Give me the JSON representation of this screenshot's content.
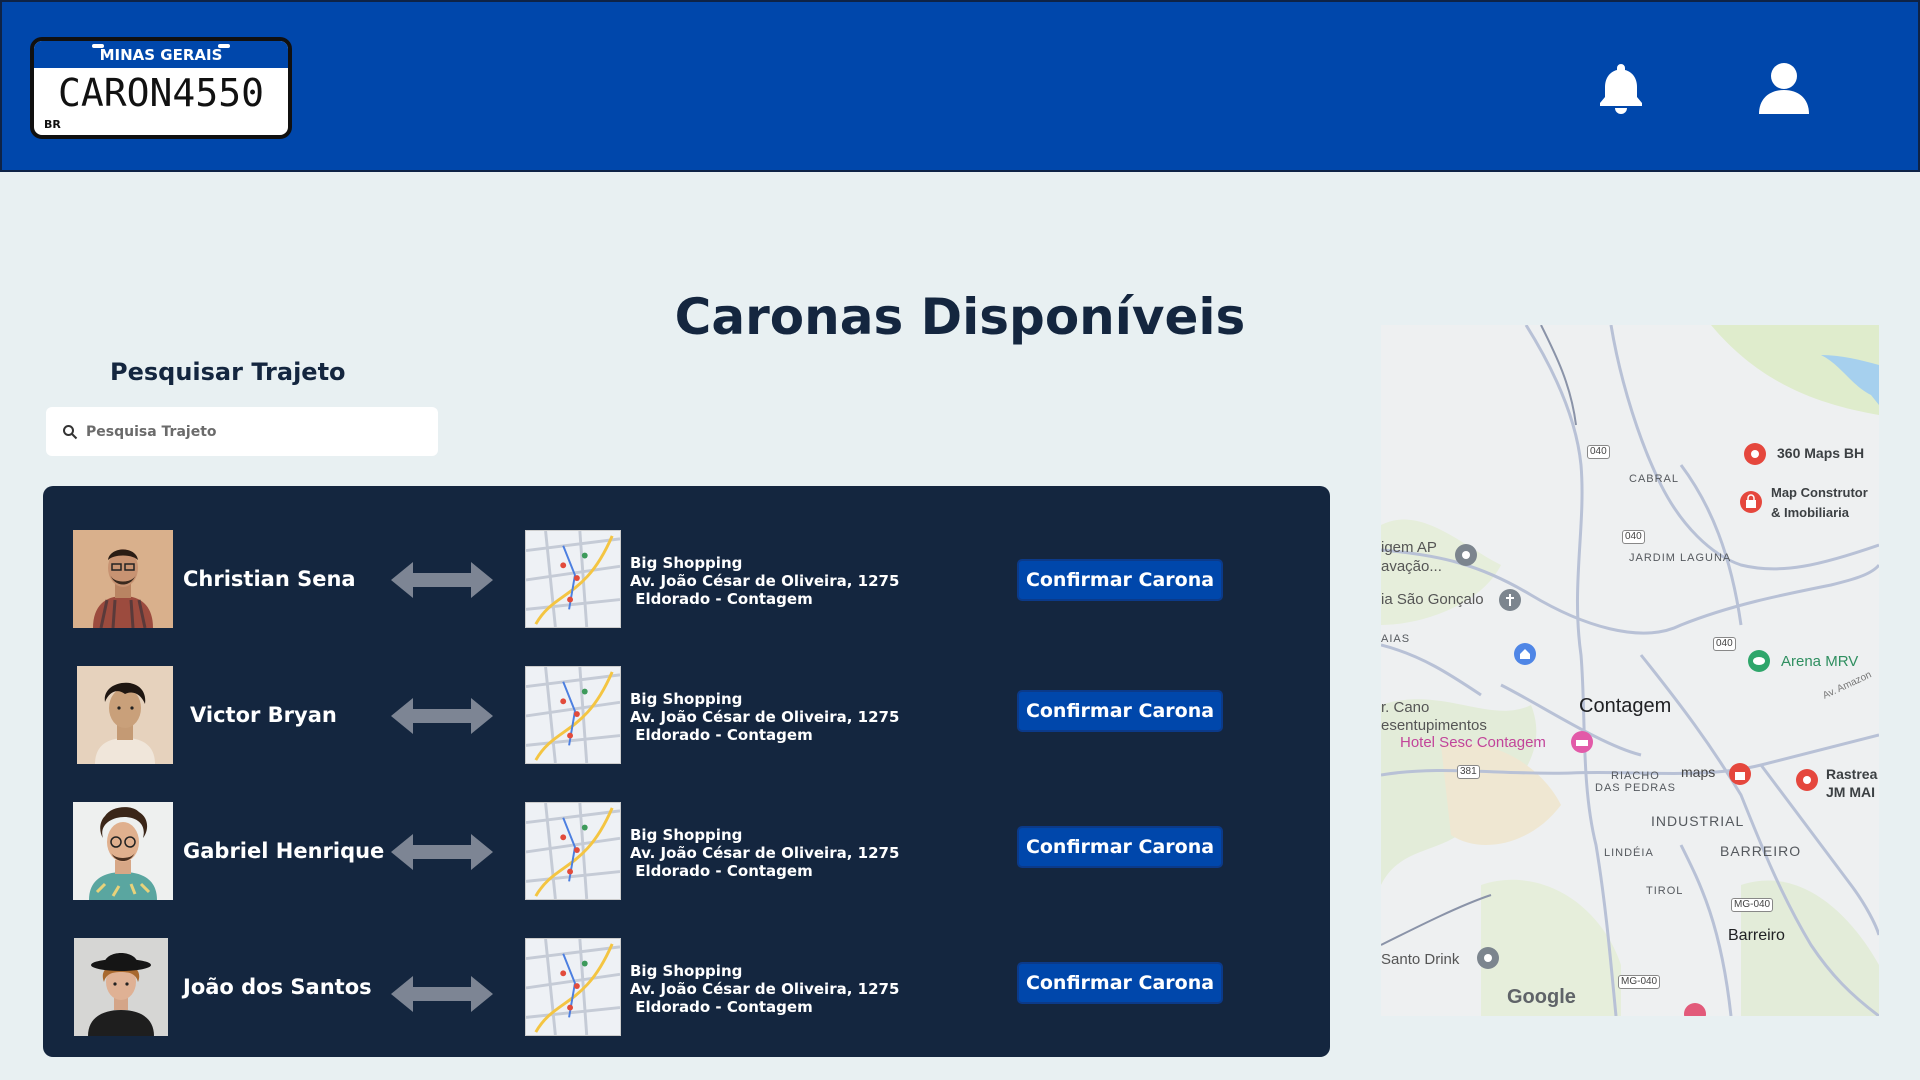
{
  "header": {
    "plate_state": "MINAS GERAIS",
    "plate_number": "CARON4550",
    "plate_country": "BR",
    "bell_icon": "bell-icon",
    "user_icon": "user-icon",
    "brand_color": "#0047ab"
  },
  "page": {
    "title": "Caronas Disponíveis"
  },
  "search": {
    "label": "Pesquisar Trajeto",
    "placeholder": "Pesquisa Trajeto",
    "value": ""
  },
  "rides": [
    {
      "name": "Christian Sena",
      "dest_title": "Big Shopping",
      "dest_line1": "Av. João César de Oliveira, 1275",
      "dest_line2": " Eldorado - Contagem",
      "button": "Confirmar Carona"
    },
    {
      "name": "Victor Bryan",
      "dest_title": "Big Shopping",
      "dest_line1": "Av. João César de Oliveira, 1275",
      "dest_line2": " Eldorado - Contagem",
      "button": "Confirmar Carona"
    },
    {
      "name": "Gabriel Henrique",
      "dest_title": "Big Shopping",
      "dest_line1": "Av. João César de Oliveira, 1275",
      "dest_line2": " Eldorado - Contagem",
      "button": "Confirmar Carona"
    },
    {
      "name": "João dos Santos",
      "dest_title": "Big Shopping",
      "dest_line1": "Av. João César de Oliveira, 1275",
      "dest_line2": " Eldorado - Contagem",
      "button": "Confirmar Carona"
    }
  ],
  "map": {
    "places": {
      "maps360": "360 Maps BH",
      "map_constr_1": "Map Construtor",
      "map_constr_2": "& Imobiliaria",
      "cabral": "CABRAL",
      "jardim": "JARDIM LAGUNA",
      "igem_1": "igem AP",
      "igem_2": "avação...",
      "sao_goncalo": "ia São Gonçalo",
      "aias": "AIAS",
      "arena": "Arena MRV",
      "cano_1": "r. Cano",
      "cano_2": "esentupimentos",
      "contagem": "Contagem",
      "hotel": "Hotel Sesc Contagem",
      "riacho_1": "RIACHO",
      "riacho_2": "DAS PEDRAS",
      "maps": "maps",
      "rastrea_1": "Rastrea",
      "rastrea_2": "JM MAI",
      "industrial": "INDUSTRIAL",
      "lindeia": "LINDÉIA",
      "barreiro_upper": "BARREIRO",
      "tirol": "TIROL",
      "barreiro": "Barreiro",
      "santo_drink": "Santo Drink",
      "google": "Google",
      "amazonas": "Av. Amazon"
    },
    "shields": {
      "s040a": "040",
      "s040b": "040",
      "s040c": "040",
      "s381": "381",
      "mg040a": "MG-040",
      "mg040b": "MG-040"
    }
  }
}
